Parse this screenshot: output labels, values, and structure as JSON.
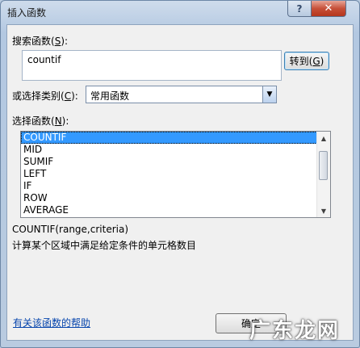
{
  "window": {
    "title": "插入函数"
  },
  "search": {
    "label_prefix": "搜索函数(",
    "label_key": "S",
    "label_suffix": "):",
    "value": "countif",
    "goto_prefix": "转到(",
    "goto_key": "G",
    "goto_suffix": ")"
  },
  "category": {
    "label_prefix": "或选择类别(",
    "label_key": "C",
    "label_suffix": "):",
    "selected": "常用函数"
  },
  "functions": {
    "label_prefix": "选择函数(",
    "label_key": "N",
    "label_suffix": "):",
    "items": [
      "COUNTIF",
      "MID",
      "SUMIF",
      "LEFT",
      "IF",
      "ROW",
      "AVERAGE"
    ],
    "selected_index": 0
  },
  "description": {
    "signature": "COUNTIF(range,criteria)",
    "text": "计算某个区域中满足给定条件的单元格数目"
  },
  "footer": {
    "help_link": "有关该函数的帮助",
    "ok_label": "确定"
  },
  "watermark": "广东龙网",
  "icons": {
    "help": "question-mark-icon",
    "close": "close-x-icon",
    "dropdown": "dropdown-arrow-icon",
    "scroll_up": "scroll-up-arrow-icon",
    "scroll_down": "scroll-down-arrow-icon"
  }
}
